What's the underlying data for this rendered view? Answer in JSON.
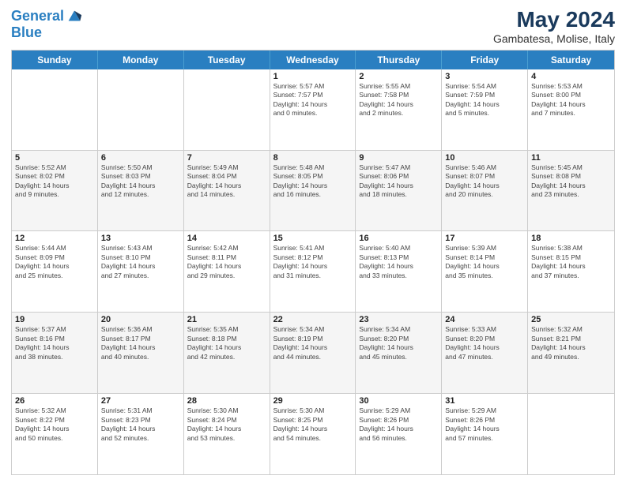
{
  "logo": {
    "line1": "General",
    "line2": "Blue"
  },
  "title": "May 2024",
  "subtitle": "Gambatesa, Molise, Italy",
  "days": [
    "Sunday",
    "Monday",
    "Tuesday",
    "Wednesday",
    "Thursday",
    "Friday",
    "Saturday"
  ],
  "rows": [
    [
      {
        "day": "",
        "text": ""
      },
      {
        "day": "",
        "text": ""
      },
      {
        "day": "",
        "text": ""
      },
      {
        "day": "1",
        "text": "Sunrise: 5:57 AM\nSunset: 7:57 PM\nDaylight: 14 hours\nand 0 minutes."
      },
      {
        "day": "2",
        "text": "Sunrise: 5:55 AM\nSunset: 7:58 PM\nDaylight: 14 hours\nand 2 minutes."
      },
      {
        "day": "3",
        "text": "Sunrise: 5:54 AM\nSunset: 7:59 PM\nDaylight: 14 hours\nand 5 minutes."
      },
      {
        "day": "4",
        "text": "Sunrise: 5:53 AM\nSunset: 8:00 PM\nDaylight: 14 hours\nand 7 minutes."
      }
    ],
    [
      {
        "day": "5",
        "text": "Sunrise: 5:52 AM\nSunset: 8:02 PM\nDaylight: 14 hours\nand 9 minutes."
      },
      {
        "day": "6",
        "text": "Sunrise: 5:50 AM\nSunset: 8:03 PM\nDaylight: 14 hours\nand 12 minutes."
      },
      {
        "day": "7",
        "text": "Sunrise: 5:49 AM\nSunset: 8:04 PM\nDaylight: 14 hours\nand 14 minutes."
      },
      {
        "day": "8",
        "text": "Sunrise: 5:48 AM\nSunset: 8:05 PM\nDaylight: 14 hours\nand 16 minutes."
      },
      {
        "day": "9",
        "text": "Sunrise: 5:47 AM\nSunset: 8:06 PM\nDaylight: 14 hours\nand 18 minutes."
      },
      {
        "day": "10",
        "text": "Sunrise: 5:46 AM\nSunset: 8:07 PM\nDaylight: 14 hours\nand 20 minutes."
      },
      {
        "day": "11",
        "text": "Sunrise: 5:45 AM\nSunset: 8:08 PM\nDaylight: 14 hours\nand 23 minutes."
      }
    ],
    [
      {
        "day": "12",
        "text": "Sunrise: 5:44 AM\nSunset: 8:09 PM\nDaylight: 14 hours\nand 25 minutes."
      },
      {
        "day": "13",
        "text": "Sunrise: 5:43 AM\nSunset: 8:10 PM\nDaylight: 14 hours\nand 27 minutes."
      },
      {
        "day": "14",
        "text": "Sunrise: 5:42 AM\nSunset: 8:11 PM\nDaylight: 14 hours\nand 29 minutes."
      },
      {
        "day": "15",
        "text": "Sunrise: 5:41 AM\nSunset: 8:12 PM\nDaylight: 14 hours\nand 31 minutes."
      },
      {
        "day": "16",
        "text": "Sunrise: 5:40 AM\nSunset: 8:13 PM\nDaylight: 14 hours\nand 33 minutes."
      },
      {
        "day": "17",
        "text": "Sunrise: 5:39 AM\nSunset: 8:14 PM\nDaylight: 14 hours\nand 35 minutes."
      },
      {
        "day": "18",
        "text": "Sunrise: 5:38 AM\nSunset: 8:15 PM\nDaylight: 14 hours\nand 37 minutes."
      }
    ],
    [
      {
        "day": "19",
        "text": "Sunrise: 5:37 AM\nSunset: 8:16 PM\nDaylight: 14 hours\nand 38 minutes."
      },
      {
        "day": "20",
        "text": "Sunrise: 5:36 AM\nSunset: 8:17 PM\nDaylight: 14 hours\nand 40 minutes."
      },
      {
        "day": "21",
        "text": "Sunrise: 5:35 AM\nSunset: 8:18 PM\nDaylight: 14 hours\nand 42 minutes."
      },
      {
        "day": "22",
        "text": "Sunrise: 5:34 AM\nSunset: 8:19 PM\nDaylight: 14 hours\nand 44 minutes."
      },
      {
        "day": "23",
        "text": "Sunrise: 5:34 AM\nSunset: 8:20 PM\nDaylight: 14 hours\nand 45 minutes."
      },
      {
        "day": "24",
        "text": "Sunrise: 5:33 AM\nSunset: 8:20 PM\nDaylight: 14 hours\nand 47 minutes."
      },
      {
        "day": "25",
        "text": "Sunrise: 5:32 AM\nSunset: 8:21 PM\nDaylight: 14 hours\nand 49 minutes."
      }
    ],
    [
      {
        "day": "26",
        "text": "Sunrise: 5:32 AM\nSunset: 8:22 PM\nDaylight: 14 hours\nand 50 minutes."
      },
      {
        "day": "27",
        "text": "Sunrise: 5:31 AM\nSunset: 8:23 PM\nDaylight: 14 hours\nand 52 minutes."
      },
      {
        "day": "28",
        "text": "Sunrise: 5:30 AM\nSunset: 8:24 PM\nDaylight: 14 hours\nand 53 minutes."
      },
      {
        "day": "29",
        "text": "Sunrise: 5:30 AM\nSunset: 8:25 PM\nDaylight: 14 hours\nand 54 minutes."
      },
      {
        "day": "30",
        "text": "Sunrise: 5:29 AM\nSunset: 8:26 PM\nDaylight: 14 hours\nand 56 minutes."
      },
      {
        "day": "31",
        "text": "Sunrise: 5:29 AM\nSunset: 8:26 PM\nDaylight: 14 hours\nand 57 minutes."
      },
      {
        "day": "",
        "text": ""
      }
    ]
  ]
}
